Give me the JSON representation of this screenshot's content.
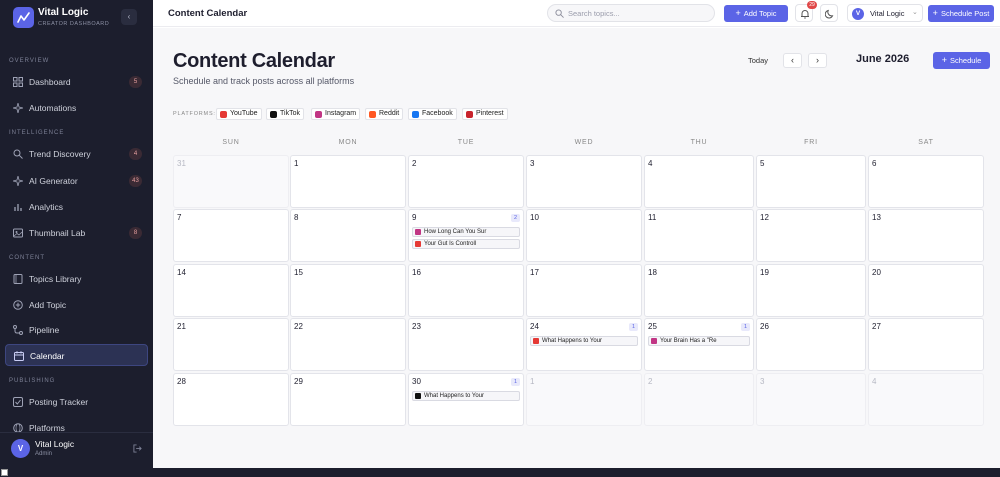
{
  "brand": {
    "title": "Vital Logic",
    "subtitle": "CREATOR DASHBOARD"
  },
  "sidebar": {
    "sections": [
      {
        "label": "OVERVIEW"
      },
      {
        "label": "INTELLIGENCE"
      },
      {
        "label": "CONTENT"
      },
      {
        "label": "PUBLISHING"
      }
    ],
    "items": [
      {
        "label": "Dashboard",
        "badge": "5",
        "icon": "grid-icon"
      },
      {
        "label": "Automations",
        "badge": "",
        "icon": "sparkle-icon"
      },
      {
        "label": "Trend Discovery",
        "badge": "4",
        "icon": "search-icon"
      },
      {
        "label": "AI Generator",
        "badge": "43",
        "icon": "sparkle-icon"
      },
      {
        "label": "Analytics",
        "badge": "",
        "icon": "chart-icon"
      },
      {
        "label": "Thumbnail Lab",
        "badge": "8",
        "icon": "image-icon"
      },
      {
        "label": "Topics Library",
        "badge": "",
        "icon": "book-icon"
      },
      {
        "label": "Add Topic",
        "badge": "",
        "icon": "plus-circle-icon"
      },
      {
        "label": "Pipeline",
        "badge": "",
        "icon": "pipeline-icon"
      },
      {
        "label": "Calendar",
        "badge": "",
        "icon": "calendar-icon"
      },
      {
        "label": "Posting Tracker",
        "badge": "",
        "icon": "check-icon"
      },
      {
        "label": "Platforms",
        "badge": "",
        "icon": "globe-icon"
      }
    ],
    "user": {
      "initial": "V",
      "name": "Vital Logic",
      "role": "Admin"
    }
  },
  "topbar": {
    "title": "Content Calendar",
    "search_placeholder": "Search topics...",
    "add_topic_label": "Add Topic",
    "notif_count": "29",
    "account_initial": "V",
    "account_name": "Vital Logic",
    "schedule_label": "Schedule Post"
  },
  "page": {
    "title": "Content Calendar",
    "subtitle": "Schedule and track posts across all platforms",
    "today_label": "Today",
    "prev": "‹",
    "next": "›",
    "month": "June 2026",
    "schedule_label": "Schedule",
    "platforms_prefix": "PLATFORMS:"
  },
  "platforms": [
    {
      "name": "YouTube",
      "color": "#e53935"
    },
    {
      "name": "TikTok",
      "color": "#111111"
    },
    {
      "name": "Instagram",
      "color": "#c13584"
    },
    {
      "name": "Reddit",
      "color": "#ff5722"
    },
    {
      "name": "Facebook",
      "color": "#1877f2"
    },
    {
      "name": "Pinterest",
      "color": "#c8232c"
    }
  ],
  "weekdays": [
    "SUN",
    "MON",
    "TUE",
    "WED",
    "THU",
    "FRI",
    "SAT"
  ],
  "calendar": {
    "weeks": [
      [
        {
          "day": "31",
          "muted": true
        },
        {
          "day": "1"
        },
        {
          "day": "2"
        },
        {
          "day": "3"
        },
        {
          "day": "4"
        },
        {
          "day": "5"
        },
        {
          "day": "6"
        }
      ],
      [
        {
          "day": "7"
        },
        {
          "day": "8"
        },
        {
          "day": "9",
          "count": "2",
          "posts": [
            {
              "title": "How Long Can You Sur",
              "color": "#c13584"
            },
            {
              "title": "Your Gut Is Controll",
              "color": "#e53935"
            }
          ]
        },
        {
          "day": "10"
        },
        {
          "day": "11"
        },
        {
          "day": "12"
        },
        {
          "day": "13"
        }
      ],
      [
        {
          "day": "14"
        },
        {
          "day": "15"
        },
        {
          "day": "16"
        },
        {
          "day": "17"
        },
        {
          "day": "18"
        },
        {
          "day": "19"
        },
        {
          "day": "20"
        }
      ],
      [
        {
          "day": "21"
        },
        {
          "day": "22"
        },
        {
          "day": "23"
        },
        {
          "day": "24",
          "count": "1",
          "posts": [
            {
              "title": "What Happens to Your",
              "color": "#e53935"
            }
          ]
        },
        {
          "day": "25",
          "count": "1",
          "posts": [
            {
              "title": "Your Brain Has a \"Re",
              "color": "#c13584"
            }
          ]
        },
        {
          "day": "26"
        },
        {
          "day": "27"
        }
      ],
      [
        {
          "day": "28"
        },
        {
          "day": "29"
        },
        {
          "day": "30",
          "count": "1",
          "posts": [
            {
              "title": "What Happens to Your",
              "color": "#111111"
            }
          ]
        },
        {
          "day": "1",
          "muted": true
        },
        {
          "day": "2",
          "muted": true
        },
        {
          "day": "3",
          "muted": true
        },
        {
          "day": "4",
          "muted": true
        }
      ]
    ]
  }
}
